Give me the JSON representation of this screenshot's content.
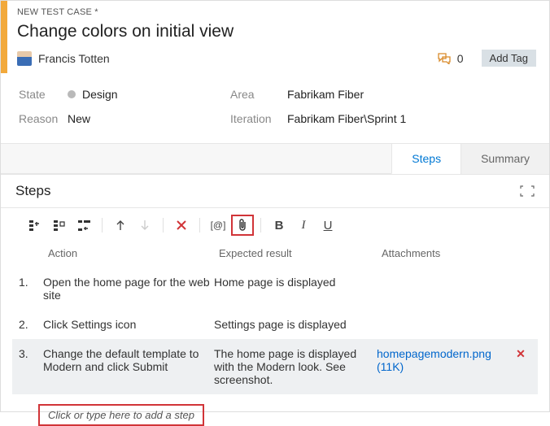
{
  "breadcrumb": "NEW TEST CASE *",
  "title": "Change colors on initial view",
  "user": "Francis Totten",
  "discussion_count": "0",
  "addtag": "Add Tag",
  "labels": {
    "state": "State",
    "reason": "Reason",
    "area": "Area",
    "iteration": "Iteration"
  },
  "state": "Design",
  "reason": "New",
  "area": "Fabrikam Fiber",
  "iteration": "Fabrikam Fiber\\Sprint 1",
  "tabs": {
    "steps": "Steps",
    "summary": "Summary"
  },
  "section": "Steps",
  "cols": {
    "action": "Action",
    "expected": "Expected result",
    "attach": "Attachments"
  },
  "steps": [
    {
      "n": "1.",
      "action": "Open the home page for the web site",
      "expected": "Home page is displayed"
    },
    {
      "n": "2.",
      "action": "Click Settings icon",
      "expected": "Settings page is displayed"
    },
    {
      "n": "3.",
      "action": "Change the default template to Modern and click Submit",
      "expected": "The home page is displayed with the Modern look. See screenshot.",
      "att_name": "homepagemodern.png",
      "att_size": "(11K)"
    }
  ],
  "addstep": "Click or type here to add a step",
  "tb": {
    "bold": "B",
    "italic": "I",
    "under": "U",
    "at": "[@]"
  }
}
